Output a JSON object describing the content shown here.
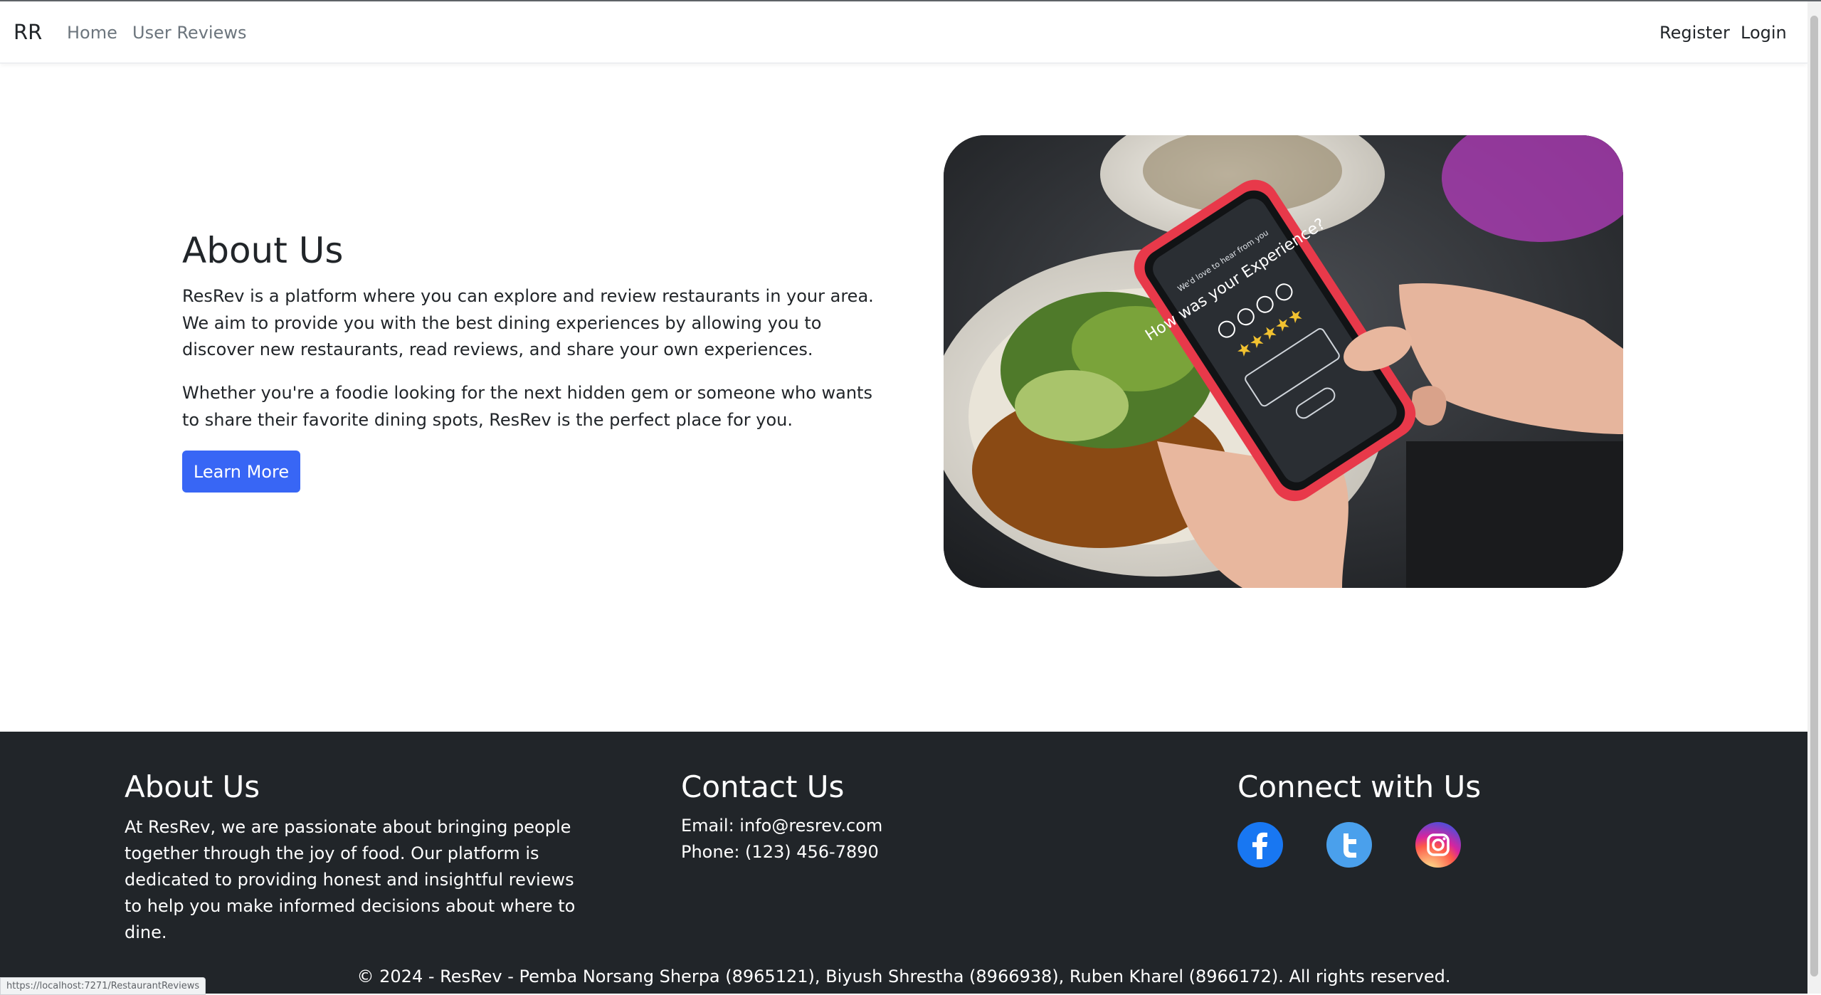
{
  "nav": {
    "brand": "RR",
    "home": "Home",
    "user_reviews": "User Reviews",
    "register": "Register",
    "login": "Login"
  },
  "hero": {
    "title": "About Us",
    "paragraph1": "ResRev is a platform where you can explore and review restaurants in your area. We aim to provide you with the best dining experiences by allowing you to discover new restaurants, read reviews, and share your own experiences.",
    "paragraph2": "Whether you're a foodie looking for the next hidden gem or someone who wants to share their favorite dining spots, ResRev is the perfect place for you.",
    "button": "Learn More",
    "image": {
      "phone_text_small": "We'd love to hear from you",
      "phone_text": "How was your Experience?",
      "rating_stars": 5
    }
  },
  "footer": {
    "about_title": "About Us",
    "about_text": "At ResRev, we are passionate about bringing people together through the joy of food. Our platform is dedicated to providing honest and insightful reviews to help you make informed decisions about where to dine.",
    "contact_title": "Contact Us",
    "email": "Email: info@resrev.com",
    "phone": "Phone: (123) 456-7890",
    "connect_title": "Connect with Us",
    "social": [
      {
        "icon": "facebook-icon",
        "color": "#1877f2"
      },
      {
        "icon": "twitter-icon",
        "color": "#4aa0ec"
      },
      {
        "icon": "instagram-icon",
        "color": "#d6249f"
      }
    ],
    "copyright": "© 2024 - ResRev - Pemba Norsang Sherpa (8965121), Biyush Shrestha (8966938), Ruben Kharel (8966172). All rights reserved."
  },
  "status_url": "https://localhost:7271/RestaurantReviews",
  "colors": {
    "primary_button": "#3866f5",
    "footer_bg": "#212529",
    "nav_muted": "#6c757d"
  }
}
